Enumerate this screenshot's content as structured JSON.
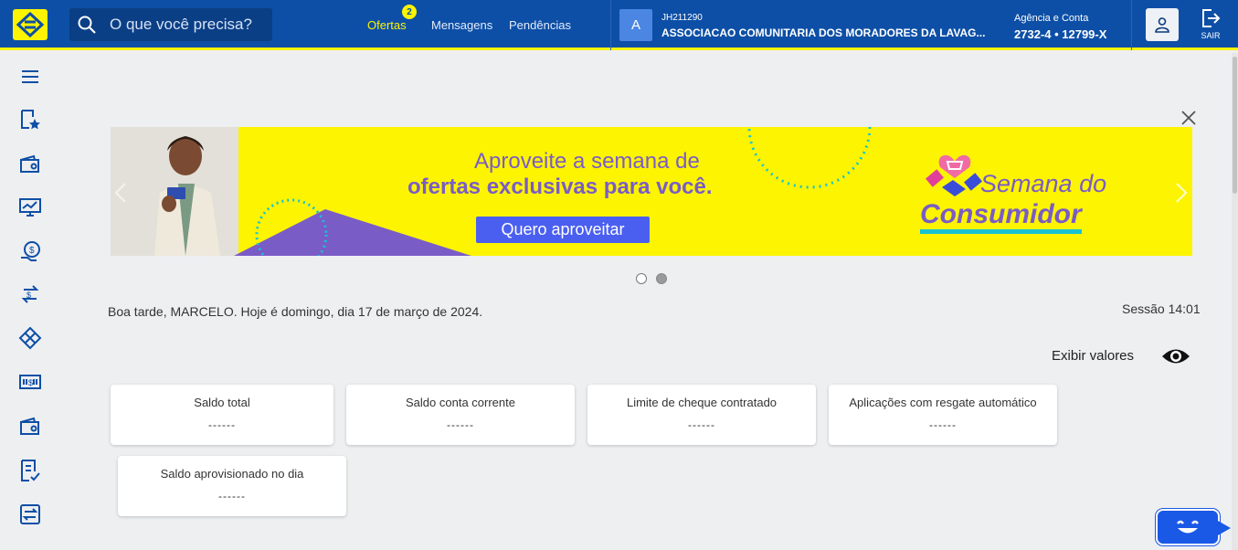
{
  "header": {
    "search_placeholder": "O que você precisa?",
    "nav": {
      "ofertas": "Ofertas",
      "ofertas_badge": "2",
      "mensagens": "Mensagens",
      "pendencias": "Pendências"
    },
    "account": {
      "avatar_letter": "A",
      "id": "JH211290",
      "name": "ASSOCIACAO COMUNITARIA DOS MORADORES DA LAVAG...",
      "agency_label": "Agência e Conta",
      "agency_value": "2732-4 • 12799-X"
    },
    "exit_label": "SAIR"
  },
  "sidebar": {
    "icons": [
      "menu-icon",
      "favorites-icon",
      "wallet-icon",
      "investments-icon",
      "loans-icon",
      "transfer-icon",
      "pix-icon",
      "payments-icon",
      "wallet-icon",
      "statement-icon",
      "exchange-icon"
    ]
  },
  "banner": {
    "line1": "Aproveite  a semana de",
    "line2": "ofertas exclusivas para você.",
    "button": "Quero aproveitar",
    "brand_line1": "Semana do",
    "brand_line2": "Consumidor"
  },
  "greeting": "Boa tarde, MARCELO.   Hoje é domingo, dia 17 de março de 2024.",
  "session": "Sessão 14:01",
  "show_values": "Exibir valores",
  "cards": [
    {
      "title": "Saldo total",
      "value": "------"
    },
    {
      "title": "Saldo conta corrente",
      "value": "------"
    },
    {
      "title": "Limite de cheque contratado",
      "value": "------"
    },
    {
      "title": "Aplicações com resgate automático",
      "value": "------"
    },
    {
      "title": "Saldo aprovisionado no dia",
      "value": "------"
    }
  ],
  "colors": {
    "brand_blue": "#0d4fa6",
    "brand_yellow": "#fcf400",
    "accent_purple": "#7a5cc6"
  }
}
